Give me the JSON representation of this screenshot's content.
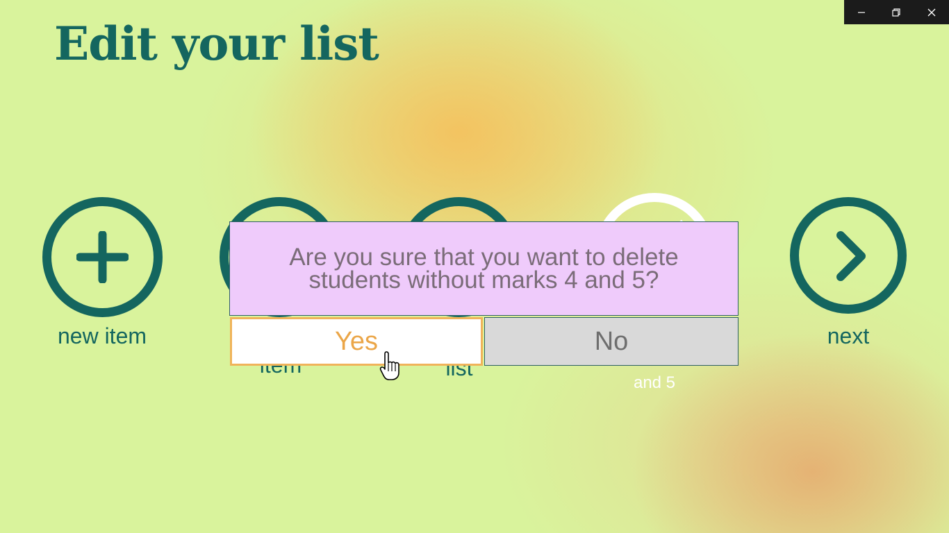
{
  "window_controls": {
    "minimize_icon": "minimize-icon",
    "restore_icon": "restore-icon",
    "close_icon": "close-icon"
  },
  "page": {
    "title": "Edit your list"
  },
  "actions": [
    {
      "label": "new item",
      "icon": "plus-circle-icon"
    },
    {
      "label": "item",
      "icon": "circle-icon"
    },
    {
      "label": "list",
      "icon": "circle-icon"
    },
    {
      "label": "and 5",
      "icon": "no-symbol-icon"
    },
    {
      "label": "next",
      "icon": "chevron-right-circle-icon"
    }
  ],
  "dialog": {
    "message": "Are you sure that you want to delete students without marks 4 and 5?",
    "yes_label": "Yes",
    "no_label": "No"
  },
  "colors": {
    "background": "#d9f39c",
    "accent": "#14665f",
    "dialog_bg": "#efcbfb",
    "yes_text": "#eba648",
    "no_bg": "#d9d9d9"
  }
}
